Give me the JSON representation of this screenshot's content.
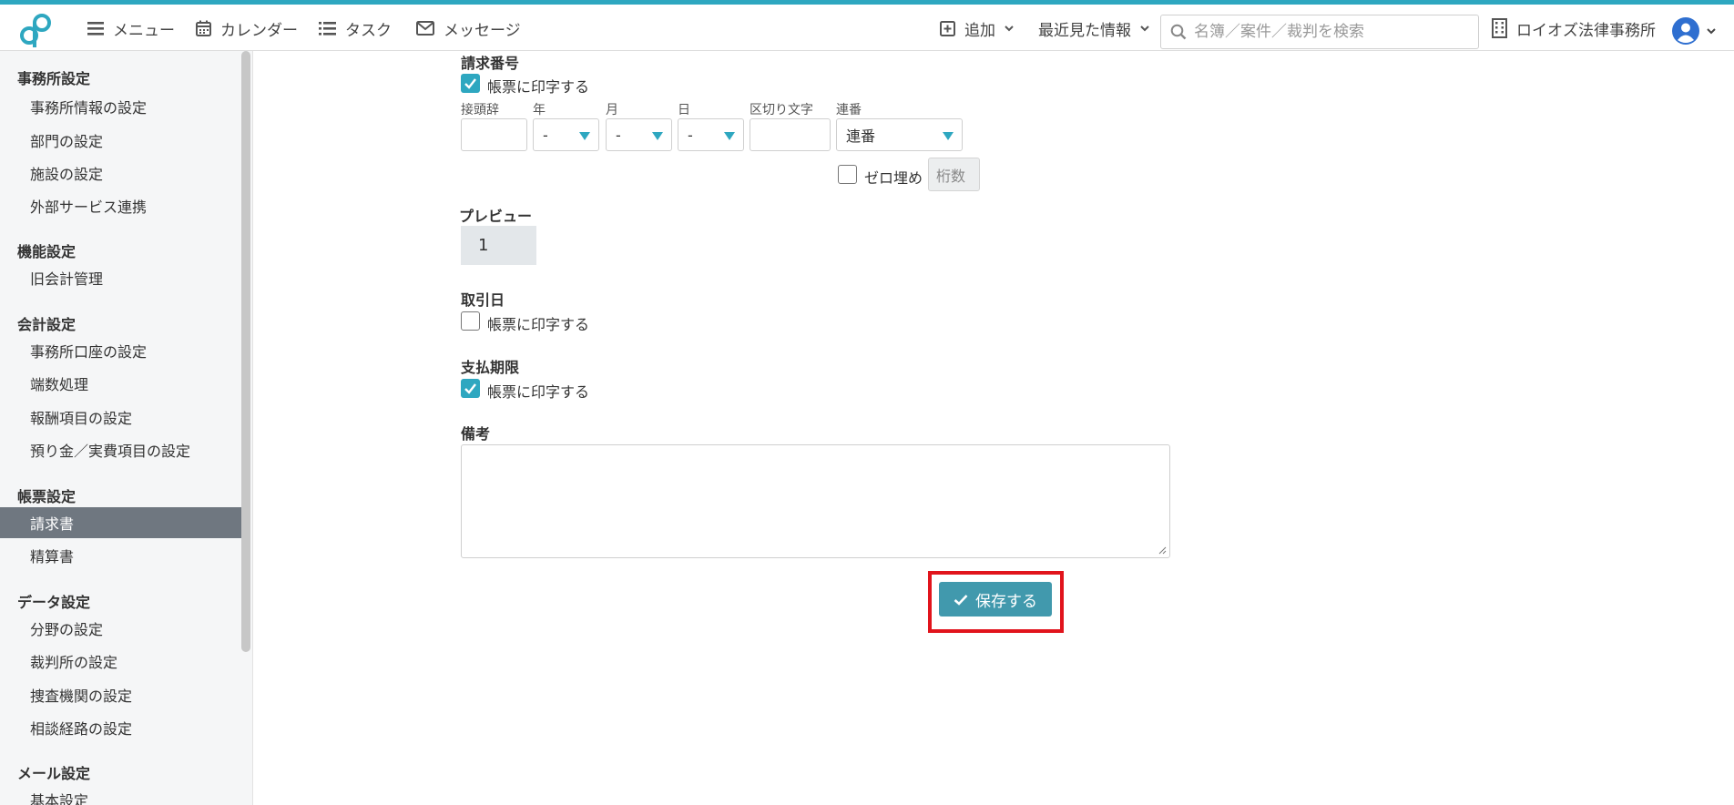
{
  "topbar": {
    "menu_label": "メニュー",
    "calendar_label": "カレンダー",
    "task_label": "タスク",
    "message_label": "メッセージ",
    "add_label": "追加",
    "recent_label": "最近見た情報",
    "search_placeholder": "名簿／案件／裁判を検索",
    "office_name": "ロイオズ法律事務所"
  },
  "sidebar": {
    "sections": [
      {
        "title": "事務所設定",
        "items": [
          "事務所情報の設定",
          "部門の設定",
          "施設の設定",
          "外部サービス連携"
        ]
      },
      {
        "title": "機能設定",
        "items": [
          "旧会計管理"
        ]
      },
      {
        "title": "会計設定",
        "items": [
          "事務所口座の設定",
          "端数処理",
          "報酬項目の設定",
          "預り金／実費項目の設定"
        ]
      },
      {
        "title": "帳票設定",
        "items": [
          "請求書",
          "精算書"
        ]
      },
      {
        "title": "データ設定",
        "items": [
          "分野の設定",
          "裁判所の設定",
          "捜査機関の設定",
          "相談経路の設定"
        ]
      },
      {
        "title": "メール設定",
        "items": [
          "基本設定"
        ]
      }
    ],
    "active_item": "請求書"
  },
  "form": {
    "invoice_number": {
      "title": "請求番号",
      "print_label": "帳票に印字する",
      "print_checked": true,
      "prefix_label": "接頭辞",
      "year_label": "年",
      "month_label": "月",
      "day_label": "日",
      "separator_label": "区切り文字",
      "serial_label": "連番",
      "year_value": "-",
      "month_value": "-",
      "day_value": "-",
      "serial_value": "連番",
      "zero_pad_label": "ゼロ埋め",
      "zero_pad_checked": false,
      "digits_placeholder": "桁数"
    },
    "preview": {
      "title": "プレビュー",
      "value": "1"
    },
    "transaction_date": {
      "title": "取引日",
      "print_label": "帳票に印字する",
      "print_checked": false
    },
    "due_date": {
      "title": "支払期限",
      "print_label": "帳票に印字する",
      "print_checked": true
    },
    "memo": {
      "title": "備考",
      "value": ""
    },
    "save_label": "保存する"
  },
  "colors": {
    "accent": "#2ea7c0",
    "save_button": "#4199ad",
    "highlight": "#e1141c",
    "active_sidebar": "#6f7780"
  }
}
